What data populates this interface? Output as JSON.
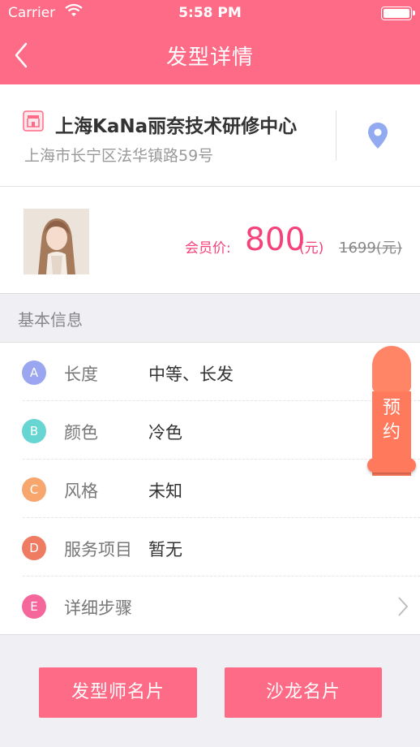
{
  "status_bar": {
    "carrier": "Carrier",
    "time": "5:58 PM"
  },
  "nav": {
    "title": "发型详情",
    "back_icon": "chevron-left-icon"
  },
  "salon": {
    "name": "上海KaNa丽奈技术研修中心",
    "address": "上海市长宁区法华镇路59号",
    "icon": "shop-icon",
    "location_icon": "map-pin-icon"
  },
  "price": {
    "label": "会员价:",
    "value": "800",
    "unit": "(元)",
    "original": "1699(元)"
  },
  "section": {
    "title": "基本信息"
  },
  "info": [
    {
      "badge": "A",
      "label": "长度",
      "value": "中等、长发",
      "color": "#9aa6ef"
    },
    {
      "badge": "B",
      "label": "颜色",
      "value": "冷色",
      "color": "#67d5d2"
    },
    {
      "badge": "C",
      "label": "风格",
      "value": "未知",
      "color": "#f7a76e"
    },
    {
      "badge": "D",
      "label": "服务项目",
      "value": "暂无",
      "color": "#ef7b62"
    },
    {
      "badge": "E",
      "label": "详细步骤",
      "value": "",
      "color": "#f5679a"
    }
  ],
  "reserve": {
    "line1": "预",
    "line2": "约",
    "color": "#ff7a5c"
  },
  "buttons": {
    "stylist": "发型师名片",
    "salon": "沙龙名片"
  },
  "colors": {
    "accent": "#fd6b86",
    "price": "#f5427b"
  }
}
